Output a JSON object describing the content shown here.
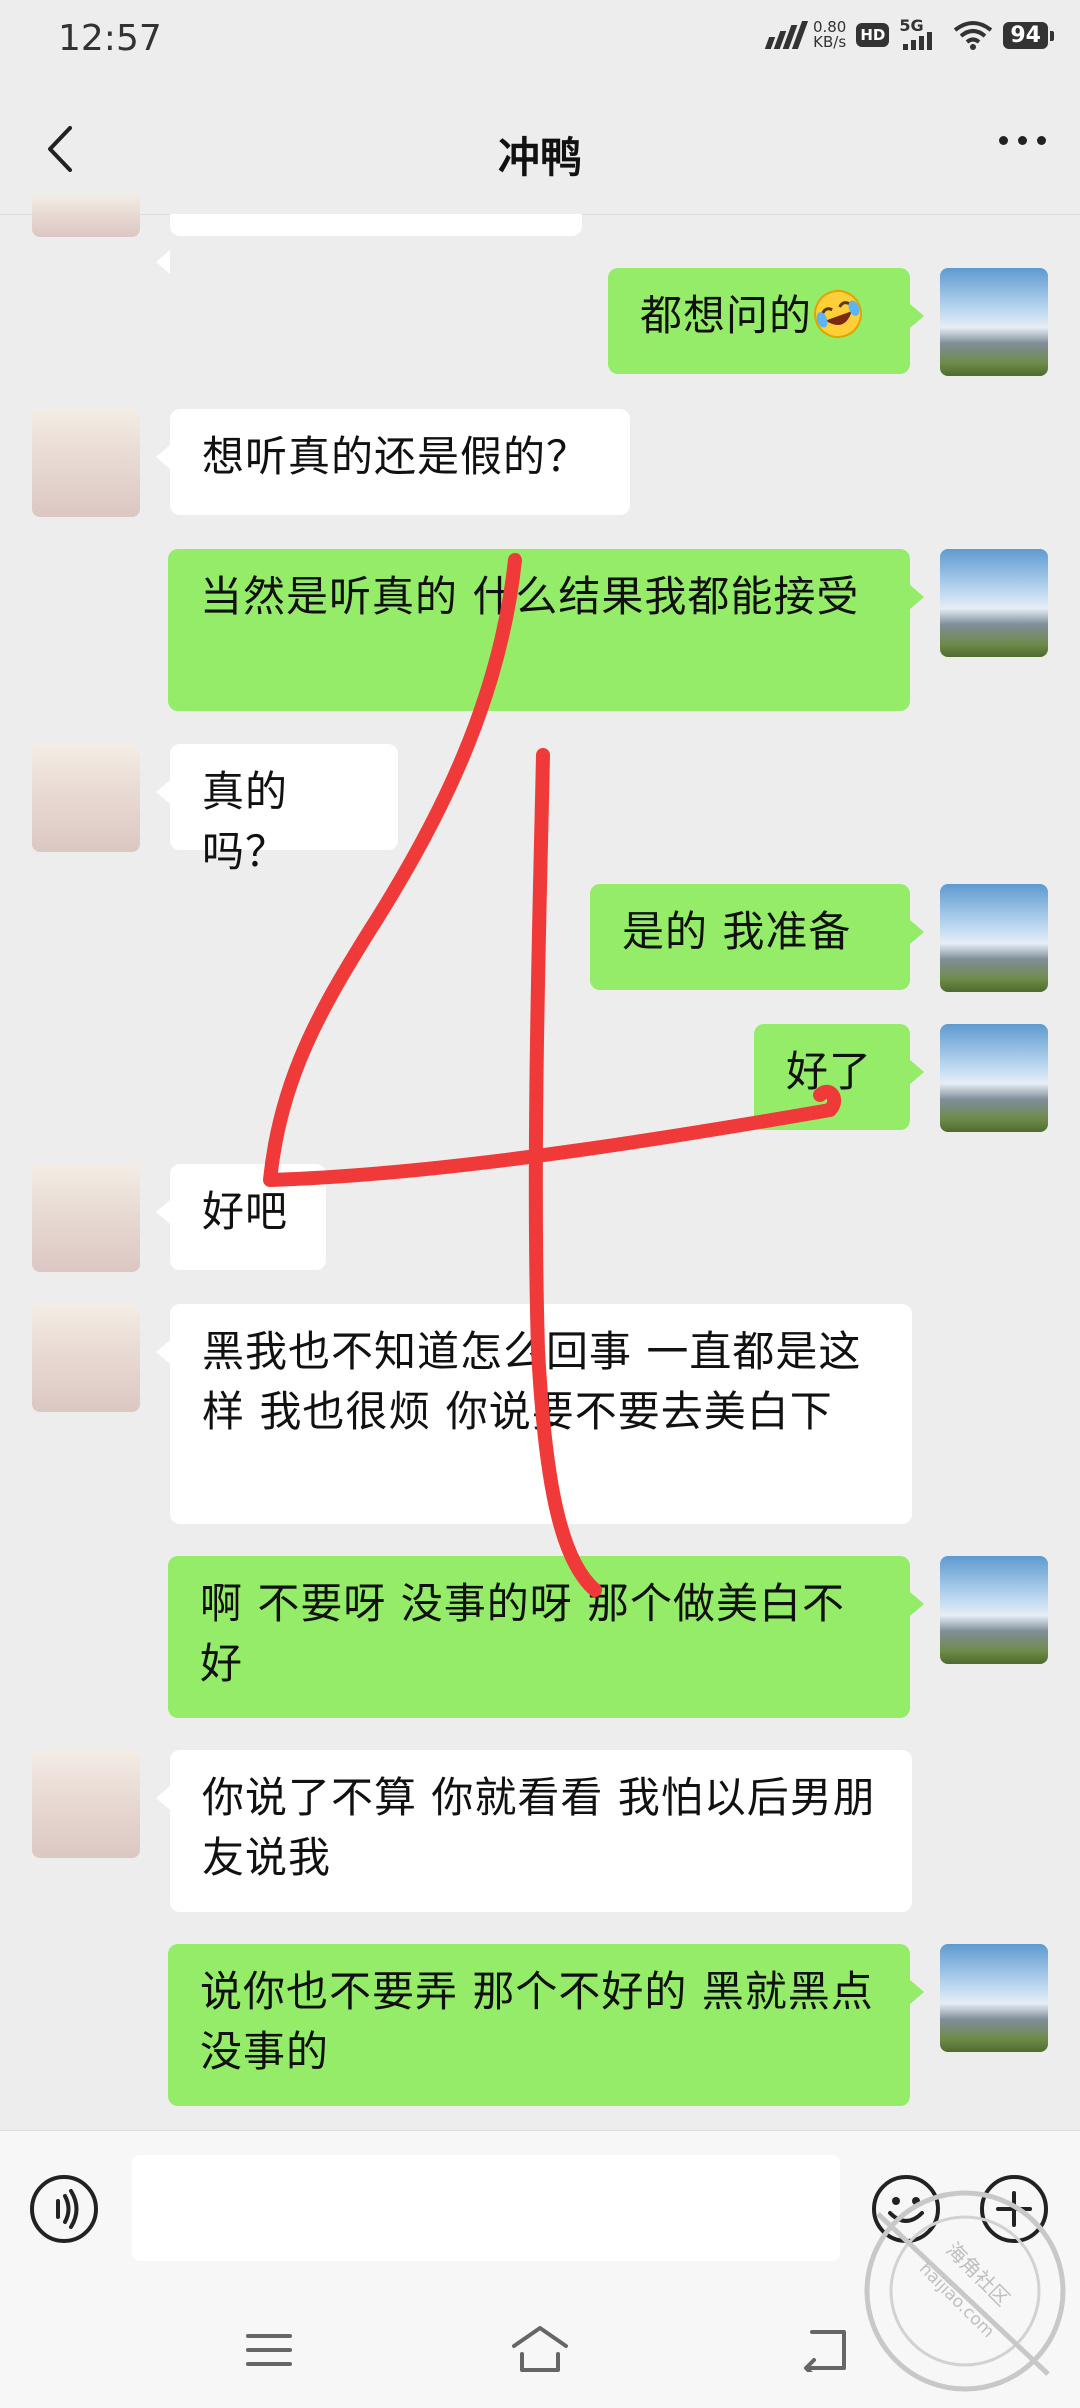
{
  "status_bar": {
    "time": "12:57",
    "net_speed_value": "0.80",
    "net_speed_unit": "KB/s",
    "hd_label": "HD",
    "network_label": "5G",
    "battery": "94"
  },
  "header": {
    "title": "冲鸭",
    "back_icon": "chevron-left-icon",
    "more_icon": "more-horizontal-icon"
  },
  "messages": [
    {
      "side": "right",
      "text": "都想问的",
      "emoji": "laughing-crying-emoji"
    },
    {
      "side": "left",
      "text": "想听真的还是假的？"
    },
    {
      "side": "right",
      "text": "当然是听真的  什么结果我都能接受"
    },
    {
      "side": "left",
      "text": "真的吗？"
    },
    {
      "side": "right",
      "text": "是的  我准备"
    },
    {
      "side": "right",
      "text": "好了"
    },
    {
      "side": "left",
      "text": "好吧"
    },
    {
      "side": "left",
      "text": "黑我也不知道怎么回事  一直都是这样  我也很烦  你说要不要去美白下"
    },
    {
      "side": "right",
      "text": "啊  不要呀  没事的呀  那个做美白不好"
    },
    {
      "side": "left",
      "text": "你说了不算  你就看看  我怕以后男朋友说我"
    },
    {
      "side": "right",
      "text": "说你也不要弄  那个不好的  黑就黑点  没事的"
    }
  ],
  "input_bar": {
    "voice_icon": "voice-icon",
    "text_value": "",
    "emoji_icon": "smiley-icon",
    "plus_icon": "plus-icon"
  },
  "nav_bar": {
    "menu_icon": "menu-icon",
    "home_icon": "home-icon",
    "back_icon": "back-arrow-icon"
  },
  "watermark": {
    "text_cn": "海角社区",
    "text_url": "haijiao.com"
  },
  "colors": {
    "background": "#ededed",
    "green_bubble": "#95ec69",
    "white_bubble": "#ffffff",
    "annotation_red": "#f03a3a"
  }
}
